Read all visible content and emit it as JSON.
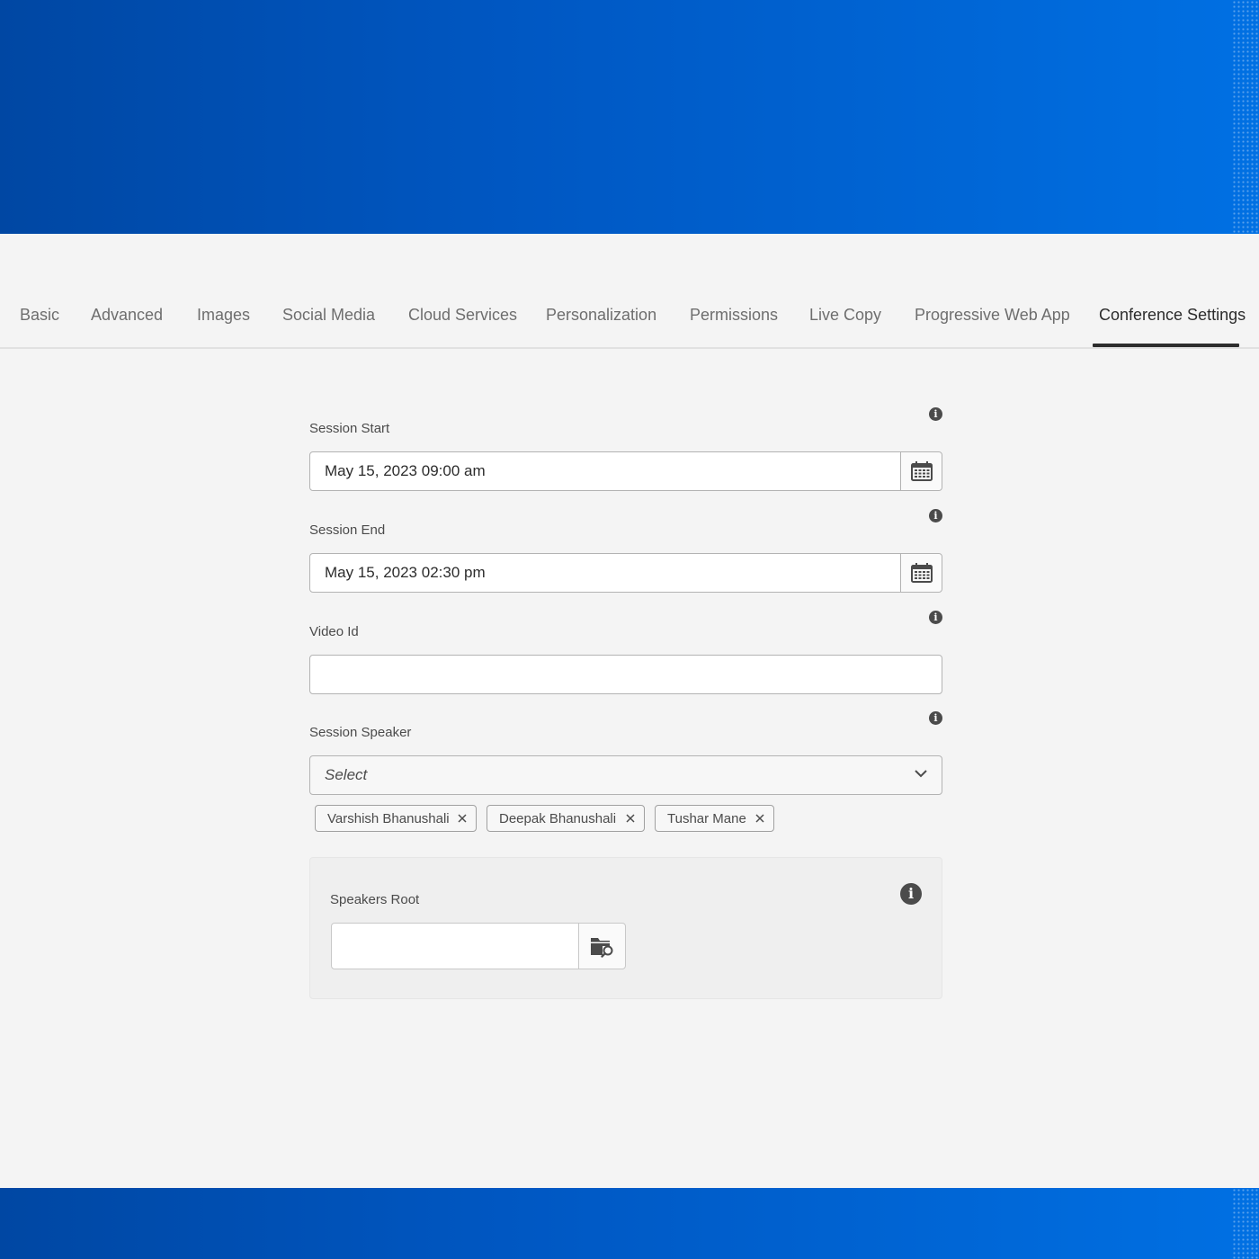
{
  "tabs": [
    {
      "label": "Basic",
      "active": false
    },
    {
      "label": "Advanced",
      "active": false
    },
    {
      "label": "Images",
      "active": false
    },
    {
      "label": "Social Media",
      "active": false
    },
    {
      "label": "Cloud Services",
      "active": false
    },
    {
      "label": "Personalization",
      "active": false
    },
    {
      "label": "Permissions",
      "active": false
    },
    {
      "label": "Live Copy",
      "active": false
    },
    {
      "label": "Progressive Web App",
      "active": false
    },
    {
      "label": "Conference Settings",
      "active": true
    }
  ],
  "form": {
    "session_start": {
      "label": "Session Start",
      "value": "May 15, 2023 09:00 am",
      "icon": "calendar-icon"
    },
    "session_end": {
      "label": "Session End",
      "value": "May 15, 2023 02:30 pm",
      "icon": "calendar-icon"
    },
    "video_id": {
      "label": "Video Id",
      "value": ""
    },
    "session_speaker": {
      "label": "Session Speaker",
      "placeholder": "Select",
      "tags": [
        "Varshish Bhanushali",
        "Deepak Bhanushali",
        "Tushar Mane"
      ]
    },
    "speakers_root": {
      "label": "Speakers Root",
      "value": "",
      "icon": "folder-search-icon"
    }
  },
  "icons": {
    "info": "i"
  },
  "colors": {
    "brand_blue": "#0057c2",
    "text": "#323232",
    "background": "#f4f4f4"
  }
}
